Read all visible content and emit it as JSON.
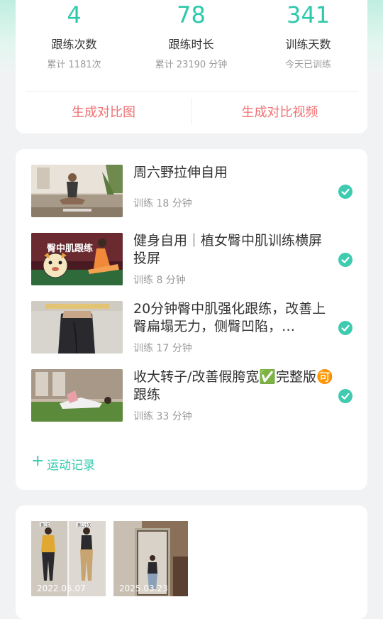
{
  "stats": [
    {
      "value": "4",
      "label": "跟练次数",
      "sub": "累计 1181次"
    },
    {
      "value": "78",
      "label": "跟练时长",
      "sub": "累计 23190 分钟"
    },
    {
      "value": "341",
      "label": "训练天数",
      "sub": "今天已训练"
    }
  ],
  "actions": {
    "compare_image": "生成对比图",
    "compare_video": "生成对比视频"
  },
  "workouts": [
    {
      "title": "周六野拉伸自用",
      "duration": "训练 18 分钟",
      "completed": true
    },
    {
      "title": "健身自用｜植女臀中肌训练横屏投屏",
      "duration": "训练 8 分钟",
      "completed": true
    },
    {
      "title": "20分钟臀中肌强化跟练，改善上臀扁塌无力，侧臀凹陷，…",
      "duration": "训练 17 分钟",
      "completed": true
    },
    {
      "title": "收大转子/改善假胯宽✅完整版🉑跟练",
      "duration": "训练 33 分钟",
      "completed": true
    }
  ],
  "thumb_overlay_text": "臀中肌跟练",
  "add_record": "运动记录",
  "photos": [
    {
      "date": "2022.05.07",
      "badges": [
        "第1天",
        "第119天"
      ]
    },
    {
      "date": "2025.03.23"
    }
  ],
  "colors": {
    "accent": "#2ec9ad",
    "action": "#f07073",
    "check": "#3fcbb0"
  }
}
